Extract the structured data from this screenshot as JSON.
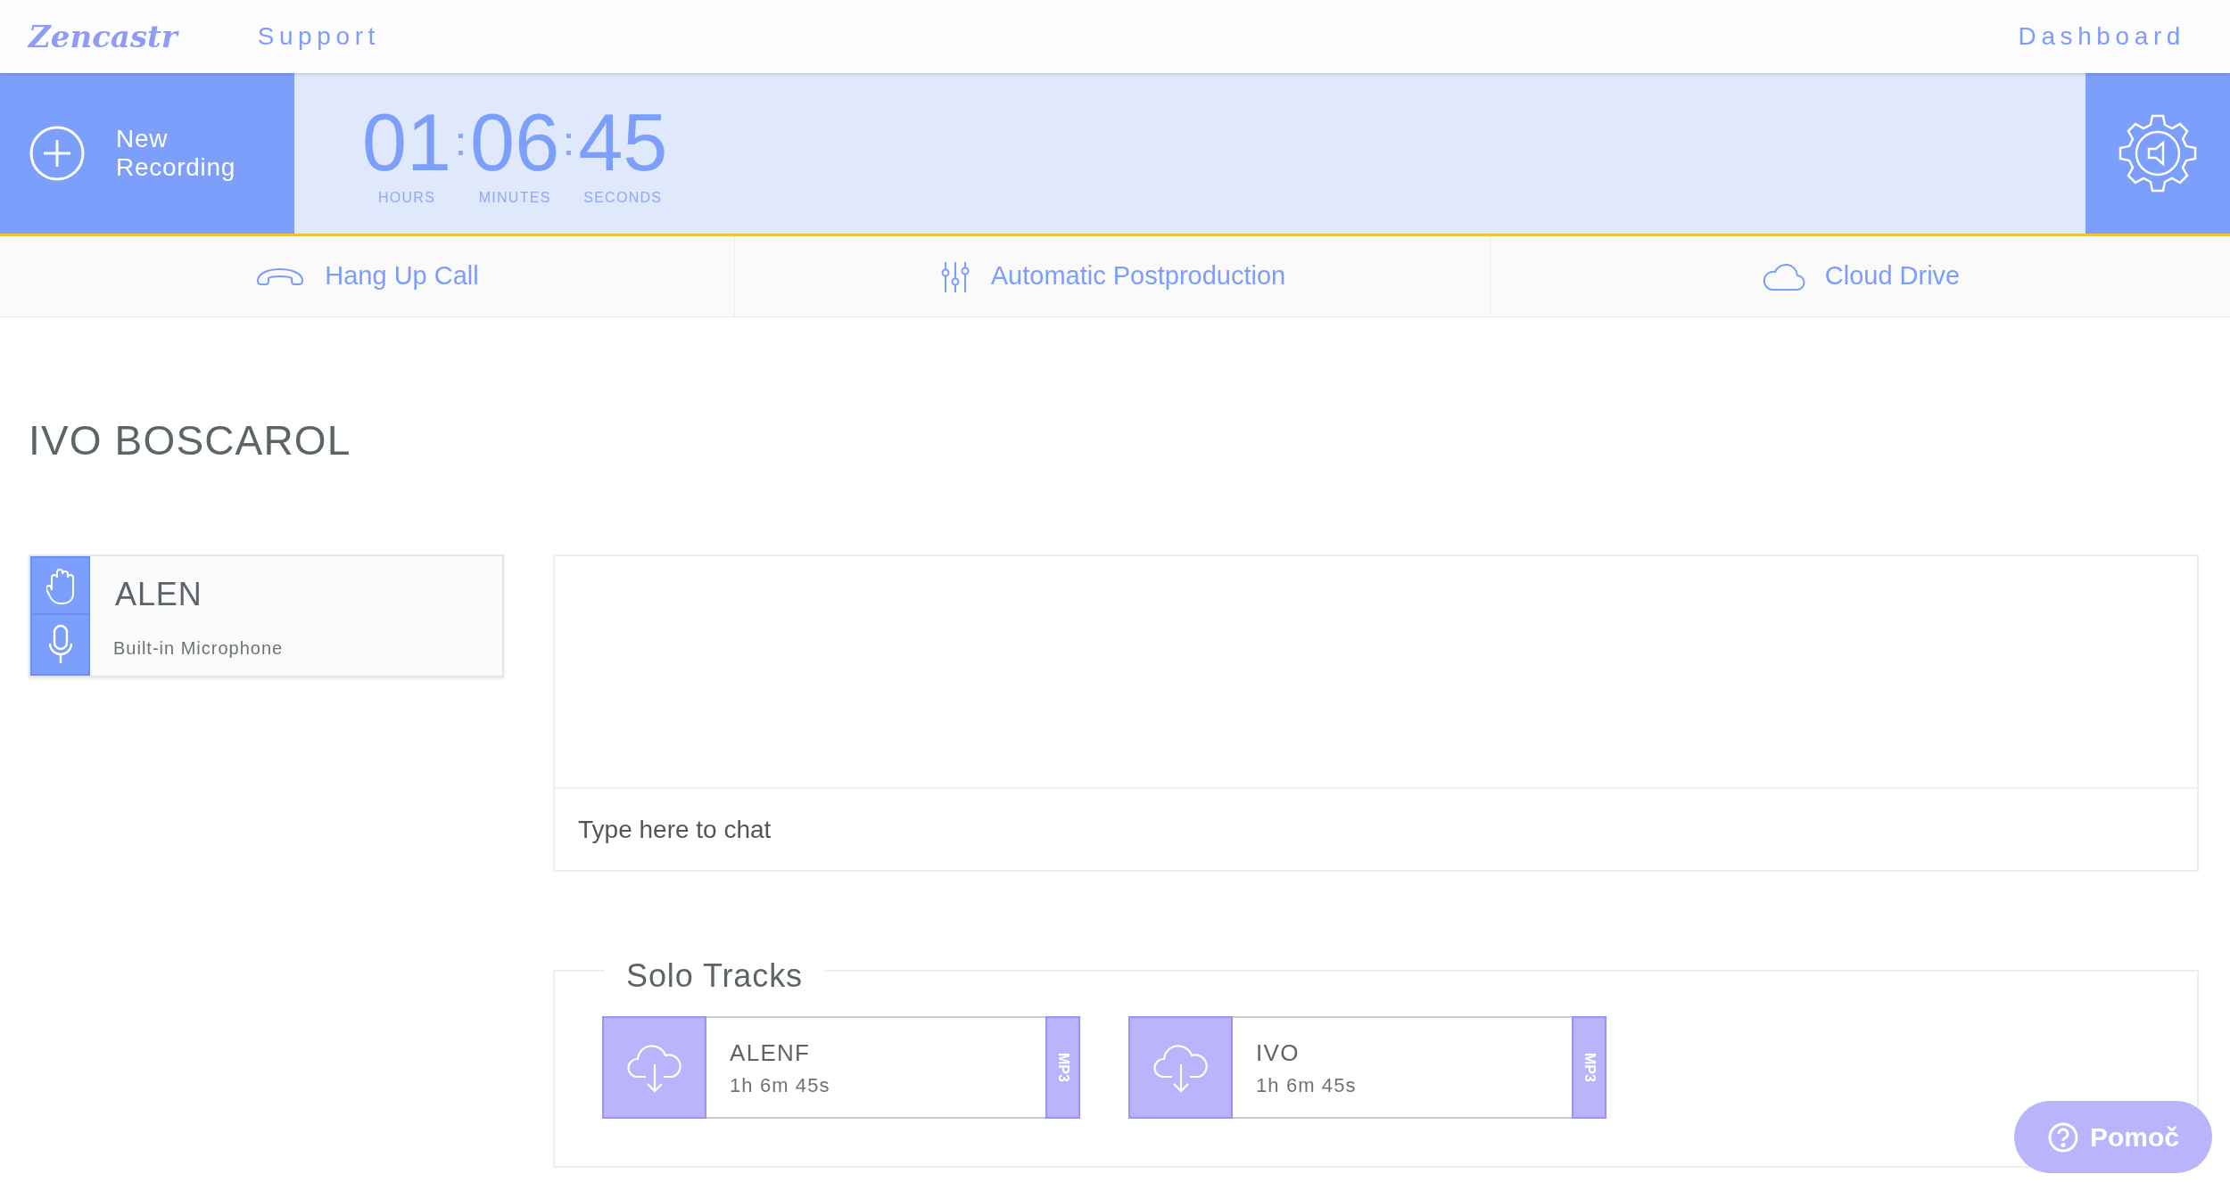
{
  "header": {
    "logo": "Zencastr",
    "links": [
      "Support"
    ],
    "dashboard": "Dashboard"
  },
  "new_recording": "New Recording",
  "timer": [
    {
      "value": "01",
      "label": "HOURS"
    },
    {
      "value": "06",
      "label": "MINUTES"
    },
    {
      "value": "45",
      "label": "SECONDS"
    }
  ],
  "actions": [
    {
      "label": "Hang Up Call",
      "kind": "hangup"
    },
    {
      "label": "Automatic Postproduction",
      "kind": "mixer"
    },
    {
      "label": "Cloud Drive",
      "kind": "cloud"
    }
  ],
  "session_title": "IVO BOSCAROL",
  "participants": [
    {
      "name": "ALEN",
      "device": "Built-in Microphone"
    }
  ],
  "chat": {
    "placeholder": "Type here to chat"
  },
  "solo_tracks": {
    "title": "Solo Tracks",
    "tracks": [
      {
        "name": "ALENF",
        "duration": "1h 6m 45s",
        "format": "MP3"
      },
      {
        "name": "IVO",
        "duration": "1h 6m 45s",
        "format": "MP3"
      }
    ]
  },
  "help_button": "Pomoč"
}
